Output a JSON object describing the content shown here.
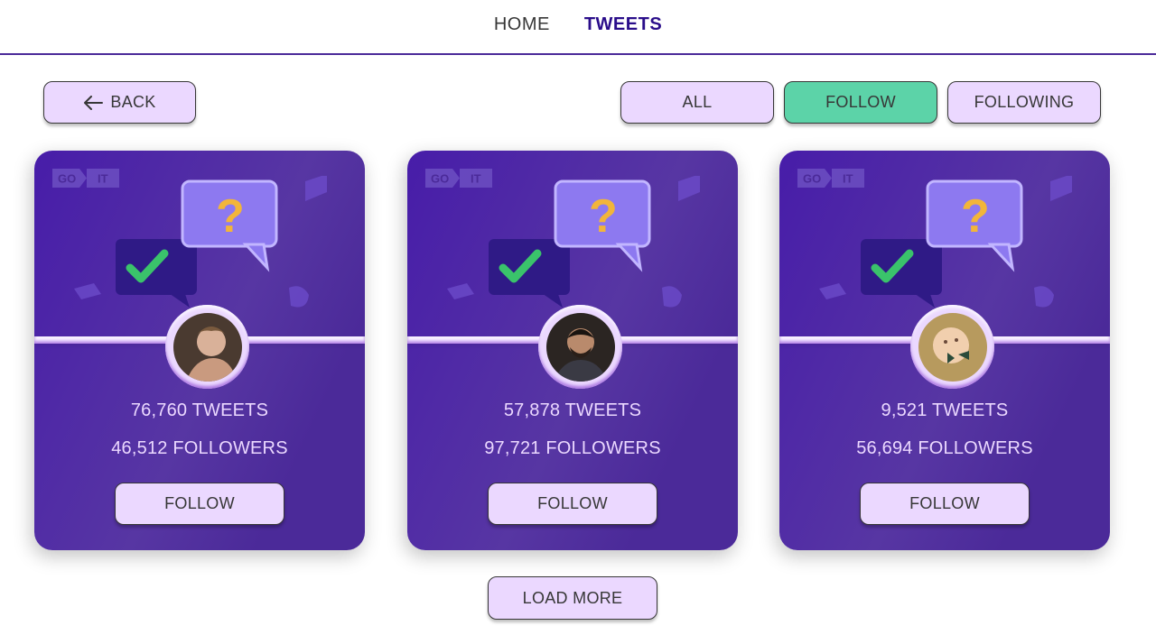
{
  "nav": {
    "home_label": "HOME",
    "tweets_label": "TWEETS"
  },
  "toolbar": {
    "back_label": "BACK",
    "filter_all_label": "ALL",
    "filter_follow_label": "FOLLOW",
    "filter_following_label": "FOLLOWING",
    "active_filter": "FOLLOW"
  },
  "logo": {
    "part1": "GO",
    "part2": "IT"
  },
  "cards": [
    {
      "tweets": "76,760 TWEETS",
      "followers": "46,512 FOLLOWERS",
      "button_label": "FOLLOW",
      "avatar_icon": "user-avatar-man-profile"
    },
    {
      "tweets": "57,878 TWEETS",
      "followers": "97,721 FOLLOWERS",
      "button_label": "FOLLOW",
      "avatar_icon": "user-avatar-man-beard"
    },
    {
      "tweets": "9,521 TWEETS",
      "followers": "56,694 FOLLOWERS",
      "button_label": "FOLLOW",
      "avatar_icon": "user-avatar-baby"
    }
  ],
  "load_more_label": "LOAD MORE",
  "colors": {
    "accent": "#4b2a99",
    "button_bg": "#ebd8ff",
    "active_filter_bg": "#5cd3a8",
    "card_gradient_start": "#471ca9",
    "card_gradient_mid": "#5736a3",
    "text": "#373737",
    "nav_active": "#2a0d8a"
  }
}
